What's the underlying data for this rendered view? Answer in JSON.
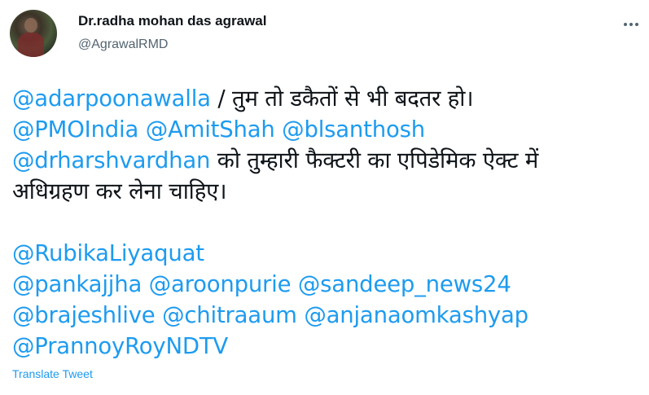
{
  "author": {
    "display_name": "Dr.radha mohan das agrawal",
    "handle": "@AgrawalRMD"
  },
  "tweet": {
    "line1": {
      "mention": "@adarpoonawalla",
      "text": " / तुम तो डकैतों से भी बदतर हो।"
    },
    "line2": {
      "m1": "@PMOIndia",
      "m2": "@AmitShah",
      "m3": "@blsanthosh"
    },
    "line3": {
      "mention": "@drharshvardhan",
      "text": " को तुम्हारी फैक्टरी का एपिडेमिक ऐक्ट में"
    },
    "line4": {
      "text": "अधिग्रहण कर लेना चाहिए।"
    },
    "line5": {
      "mention": "@RubikaLiyaquat"
    },
    "line6": {
      "m1": "@pankajjha",
      "m2": "@aroonpurie",
      "m3": "@sandeep_news24"
    },
    "line7": {
      "m1": "@brajeshlive",
      "m2": "@chitraaum",
      "m3": "@anjanaomkashyap"
    },
    "line8": {
      "mention": "@PrannoyRoyNDTV"
    }
  },
  "actions": {
    "translate_label": "Translate Tweet",
    "more_icon": "more-horizontal-icon"
  },
  "colors": {
    "mention": "#1d9bf0",
    "text": "#0f1419",
    "secondary": "#536471"
  }
}
